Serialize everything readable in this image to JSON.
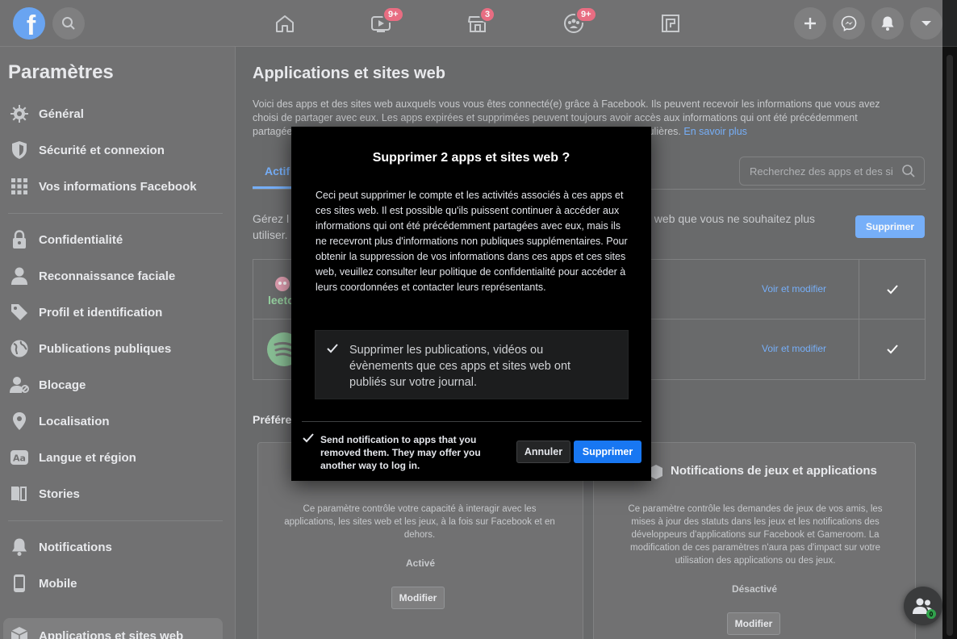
{
  "topbar": {
    "logo": "f",
    "badges": {
      "watch": "9+",
      "marketplace": "3",
      "groups": "9+"
    }
  },
  "sidebar": {
    "title": "Paramètres",
    "items": [
      {
        "label": "Général"
      },
      {
        "label": "Sécurité et connexion"
      },
      {
        "label": "Vos informations Facebook"
      },
      {
        "label": "Confidentialité"
      },
      {
        "label": "Reconnaissance faciale"
      },
      {
        "label": "Profil et identification"
      },
      {
        "label": "Publications publiques"
      },
      {
        "label": "Blocage"
      },
      {
        "label": "Localisation"
      },
      {
        "label": "Langue et région"
      },
      {
        "label": "Stories"
      },
      {
        "label": "Notifications"
      },
      {
        "label": "Mobile"
      },
      {
        "label": "Applications et sites web"
      }
    ]
  },
  "main": {
    "title": "Applications et sites web",
    "desc_line1": "Voici des apps et des sites web auxquels vous vous êtes connecté(e) grâce à Facebook. Ils peuvent recevoir les informations que vous avez",
    "desc_line2": "choisi de partager avec eux. Les apps expirées et supprimées peuvent toujours avoir accès aux informations qui ont été précédemment",
    "desc_line3_start": "partagées",
    "desc_line3_end": "ulières.",
    "learn_more": "En savoir plus",
    "tab_active": "Actif",
    "search_placeholder": "Recherchez des apps et des si",
    "manage_start": "Gérez l",
    "manage_end": "es web que vous ne souhaitez plus",
    "manage_line2": "utiliser.",
    "delete_button": "Supprimer",
    "apps": [
      {
        "name": "leetc",
        "edit": "Voir et modifier"
      },
      {
        "name": "spotify",
        "edit": "Voir et modifier"
      }
    ],
    "prefs_title": "Préfére",
    "cards": [
      {
        "desc": "Ce paramètre contrôle votre capacité à interagir avec les applications, les sites web et les jeux, à la fois sur Facebook et en dehors.",
        "state": "Activé",
        "button": "Modifier"
      },
      {
        "title": "Notifications de jeux et applications",
        "desc": "Ce paramètre contrôle les demandes de jeux de vos amis, les mises à jour des statuts dans les jeux et les notifications des développeurs d'applications sur Facebook et Gameroom. La modification de ces paramètres n'aura pas d'impact sur votre utilisation des applications ou des jeux.",
        "state": "Désactivé",
        "button": "Modifier"
      }
    ]
  },
  "dialog": {
    "title": "Supprimer 2 apps et sites web ?",
    "body": "Ceci peut supprimer le compte et les activités associés à ces apps et ces sites web. Il est possible qu'ils puissent continuer à accéder aux informations qui ont été précédemment partagées avec eux, mais ils ne recevront plus d'informations non publiques supplémentaires. Pour obtenir la suppression de vos informations dans ces apps et ces sites web, veuillez consulter leur politique de confidentialité pour accéder à leurs coordonnées et contacter leurs représentants.",
    "option": "Supprimer les publications, vidéos ou évènements que ces apps et sites web ont publiés sur votre journal.",
    "notify": "Send notification to apps that you removed them. They may offer you another way to log in.",
    "cancel": "Annuler",
    "confirm": "Supprimer"
  },
  "chat": {
    "count": "0"
  },
  "colors": {
    "accent": "#1877f2",
    "badge": "#e41e3f",
    "online": "#31a24c"
  }
}
